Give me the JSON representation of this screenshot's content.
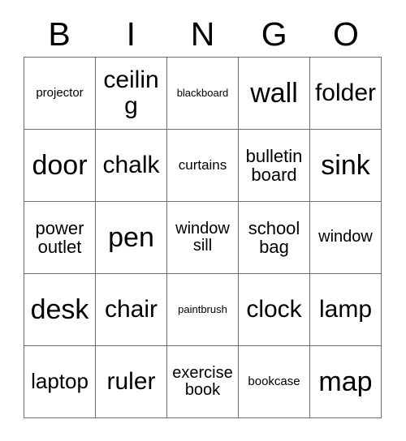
{
  "card": {
    "title_letters": [
      "B",
      "I",
      "N",
      "G",
      "O"
    ],
    "columns": 5,
    "rows": 5,
    "grid_line_color": "#6e6e6e",
    "text_color": "#000000",
    "background_color": "#ffffff",
    "cells": [
      [
        {
          "label": "projector",
          "size": "s"
        },
        {
          "label": "ceiling",
          "size": "xxl"
        },
        {
          "label": "blackboard",
          "size": "xs"
        },
        {
          "label": "wall",
          "size": "3xl"
        },
        {
          "label": "folder",
          "size": "xxl"
        }
      ],
      [
        {
          "label": "door",
          "size": "3xl"
        },
        {
          "label": "chalk",
          "size": "xxl"
        },
        {
          "label": "curtains",
          "size": "m"
        },
        {
          "label": "bulletin board",
          "size": "l"
        },
        {
          "label": "sink",
          "size": "3xl"
        }
      ],
      [
        {
          "label": "power outlet",
          "size": "l"
        },
        {
          "label": "pen",
          "size": "3xl"
        },
        {
          "label": "window sill",
          "size": "ml"
        },
        {
          "label": "school bag",
          "size": "l"
        },
        {
          "label": "window",
          "size": "ml"
        }
      ],
      [
        {
          "label": "desk",
          "size": "3xl"
        },
        {
          "label": "chair",
          "size": "xxl"
        },
        {
          "label": "paintbrush",
          "size": "xs"
        },
        {
          "label": "clock",
          "size": "xxl"
        },
        {
          "label": "lamp",
          "size": "xxl"
        }
      ],
      [
        {
          "label": "laptop",
          "size": "xl"
        },
        {
          "label": "ruler",
          "size": "xxl"
        },
        {
          "label": "exercise book",
          "size": "ml"
        },
        {
          "label": "bookcase",
          "size": "s"
        },
        {
          "label": "map",
          "size": "3xl"
        }
      ]
    ]
  }
}
